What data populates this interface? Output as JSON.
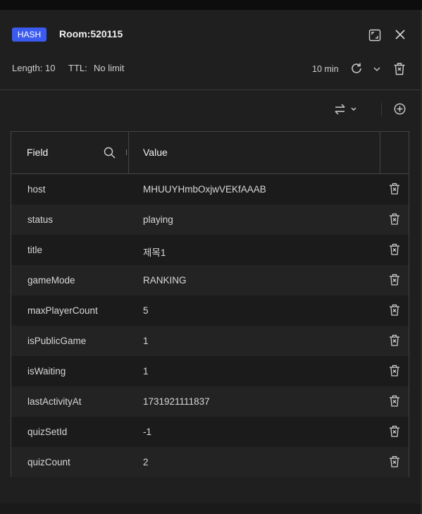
{
  "header": {
    "type_badge": "HASH",
    "key_name": "Room:520115",
    "length_label": "Length: 10",
    "ttl_label": "TTL:",
    "ttl_value": "No limit",
    "refresh_interval": "10 min"
  },
  "table": {
    "columns": {
      "field": "Field",
      "value": "Value"
    },
    "rows": [
      {
        "field": "host",
        "value": "MHUUYHmbOxjwVEKfAAAB"
      },
      {
        "field": "status",
        "value": "playing"
      },
      {
        "field": "title",
        "value": "제목1"
      },
      {
        "field": "gameMode",
        "value": "RANKING"
      },
      {
        "field": "maxPlayerCount",
        "value": "5"
      },
      {
        "field": "isPublicGame",
        "value": "1"
      },
      {
        "field": "isWaiting",
        "value": "1"
      },
      {
        "field": "lastActivityAt",
        "value": "1731921111837"
      },
      {
        "field": "quizSetId",
        "value": "-1"
      },
      {
        "field": "quizCount",
        "value": "2"
      }
    ]
  },
  "colors": {
    "badge": "#3b5bf0",
    "background": "#1f1f1f",
    "row_alt": "#232323",
    "border": "#444444",
    "status_dot": "#22b573"
  },
  "icons": {
    "expand": "expand-icon",
    "close": "close-icon",
    "refresh": "refresh-icon",
    "chevron": "chevron-down-icon",
    "delete": "trash-icon",
    "swap": "swap-icon",
    "add": "add-circle-icon",
    "search": "search-icon",
    "resize": "column-resize-handle"
  }
}
